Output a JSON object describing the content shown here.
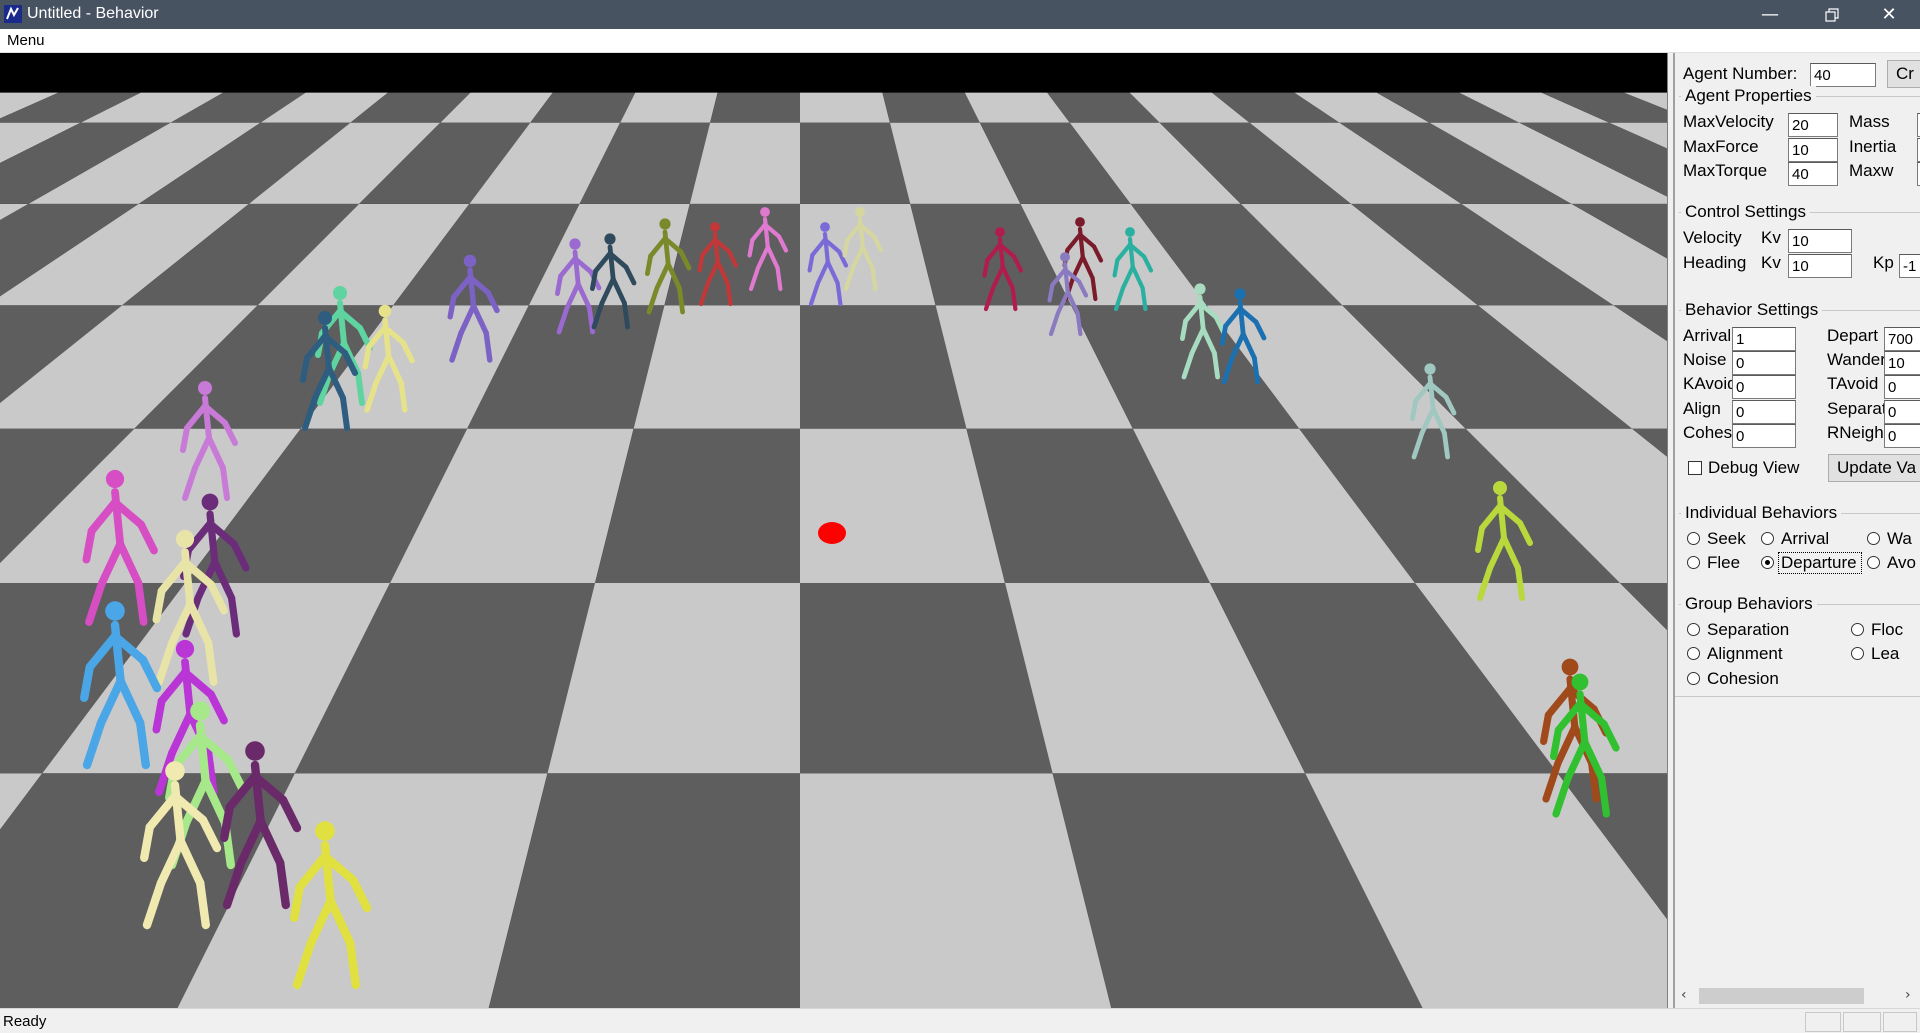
{
  "window": {
    "title": "Untitled - Behavior",
    "minimize_icon": "minimize-icon",
    "restore_icon": "restore-icon",
    "close_icon": "close-icon"
  },
  "menubar": {
    "items": [
      "Menu"
    ]
  },
  "panel": {
    "agent_number_label": "Agent Number:",
    "agent_number_value": "40",
    "create_button": "Cr",
    "agent_properties": {
      "title": "Agent Properties",
      "max_velocity_label": "MaxVelocity",
      "max_velocity": "20",
      "max_force_label": "MaxForce",
      "max_force": "10",
      "max_torque_label": "MaxTorque",
      "max_torque": "40",
      "mass_label": "Mass",
      "inertia_label": "Inertia",
      "maxw_label": "Maxw"
    },
    "control_settings": {
      "title": "Control Settings",
      "velocity_label": "Velocity",
      "velocity_kv_label": "Kv",
      "velocity_kv": "10",
      "heading_label": "Heading",
      "heading_kv_label": "Kv",
      "heading_kv": "10",
      "kp_label": "Kp",
      "kp": "-1"
    },
    "behavior_settings": {
      "title": "Behavior Settings",
      "arrival_label": "Arrival",
      "arrival": "1",
      "depart_label": "Depart",
      "depart": "700",
      "noise_label": "Noise",
      "noise": "0",
      "wander_label": "Wander",
      "wander": "10",
      "kavoid_label": "KAvoid",
      "kavoid": "0",
      "tavoid_label": "TAvoid",
      "tavoid": "0",
      "align_label": "Align",
      "align": "0",
      "separat_label": "Separat",
      "separat": "0",
      "cohes_label": "Cohes",
      "cohes": "0",
      "rneigh_label": "RNeigh",
      "rneigh": "0"
    },
    "debug_view_label": "Debug View",
    "debug_view_checked": false,
    "update_button": "Update Va",
    "individual_behaviors": {
      "title": "Individual Behaviors",
      "seek": "Seek",
      "arrival": "Arrival",
      "wander": "Wa",
      "flee": "Flee",
      "departure": "Departure",
      "avoid": "Avo",
      "selected": "Departure"
    },
    "group_behaviors": {
      "title": "Group Behaviors",
      "separation": "Separation",
      "flocking": "Floc",
      "alignment": "Alignment",
      "leader": "Lea",
      "cohesion": "Cohesion"
    }
  },
  "scrollbar": {
    "left_arrow": "‹",
    "right_arrow": "›"
  },
  "status": {
    "text": "Ready"
  },
  "scene": {
    "floor_light": "#c9c9c9",
    "floor_dark": "#5e5e5e",
    "target_color": "#ff0000",
    "agent_colors": [
      "#5fd3a0",
      "#e6e28a",
      "#2e5d80",
      "#c77ad6",
      "#d64dc4",
      "#6b2d7a",
      "#e8e4a8",
      "#4aa6e6",
      "#b935d6",
      "#a6e88a",
      "#f0eab0",
      "#6a2a6a",
      "#e0e040",
      "#7b62c4",
      "#9a6ad0",
      "#2f4a5c",
      "#7a8a2a",
      "#c23838",
      "#e07ad0",
      "#7a6ad8",
      "#d6d6a0",
      "#b01c4c",
      "#7a1a2a",
      "#2ab0a0",
      "#8a7ac0",
      "#a8dcc0",
      "#1a70b0",
      "#a0c8c0",
      "#b8d83c",
      "#a04a1c",
      "#30c030"
    ]
  }
}
